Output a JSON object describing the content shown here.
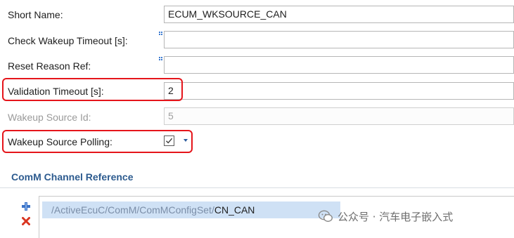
{
  "form": {
    "short_name": {
      "label": "Short Name:",
      "value": "ECUM_WKSOURCE_CAN"
    },
    "check_wakeup_timeout": {
      "label": "Check Wakeup Timeout [s]:",
      "value": ""
    },
    "reset_reason_ref": {
      "label": "Reset Reason Ref:",
      "value": ""
    },
    "validation_timeout": {
      "label": "Validation Timeout [s]:",
      "value": "2"
    },
    "wakeup_source_id": {
      "label": "Wakeup Source Id:",
      "value": "5"
    },
    "wakeup_source_polling": {
      "label": "Wakeup Source Polling:",
      "checked": true,
      "checkmark": "✓"
    }
  },
  "comm_channel_reference": {
    "title": "ComM Channel Reference",
    "path_prefix": "/ActiveEcuC/ComM/ComMConfigSet/",
    "path_tail": "CN_CAN"
  },
  "watermark": {
    "text": "公众号 · 汽车电子嵌入式"
  },
  "colors": {
    "highlight_border": "#e5151b",
    "section_title": "#2d5b8f",
    "selection": "#cfe1f5",
    "add_icon": "#3b73c8",
    "delete_icon": "#d9341f"
  }
}
